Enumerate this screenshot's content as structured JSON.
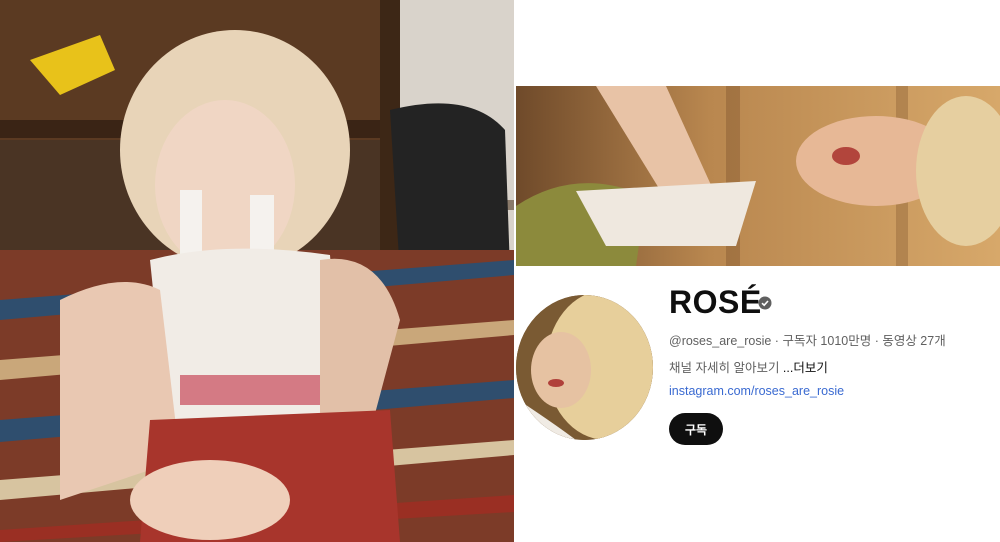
{
  "photo_left": {
    "icon": "portrait-photo"
  },
  "channel": {
    "banner_icon": "channel-banner-image",
    "avatar_icon": "channel-avatar-image",
    "name": "ROSÉ",
    "verified_icon": "verified-badge-icon",
    "handle": "@roses_are_rosie",
    "separator": " · ",
    "subscribers": "구독자 1010만명",
    "videos": "동영상 27개",
    "description": "채널 자세히 알아보기 ",
    "more_label": "...더보기",
    "link": "instagram.com/roses_are_rosie",
    "subscribe_label": "구독"
  },
  "colors": {
    "subscribe_bg": "#0f0f0f",
    "link": "#3a6ad1",
    "meta_text": "#606060"
  }
}
